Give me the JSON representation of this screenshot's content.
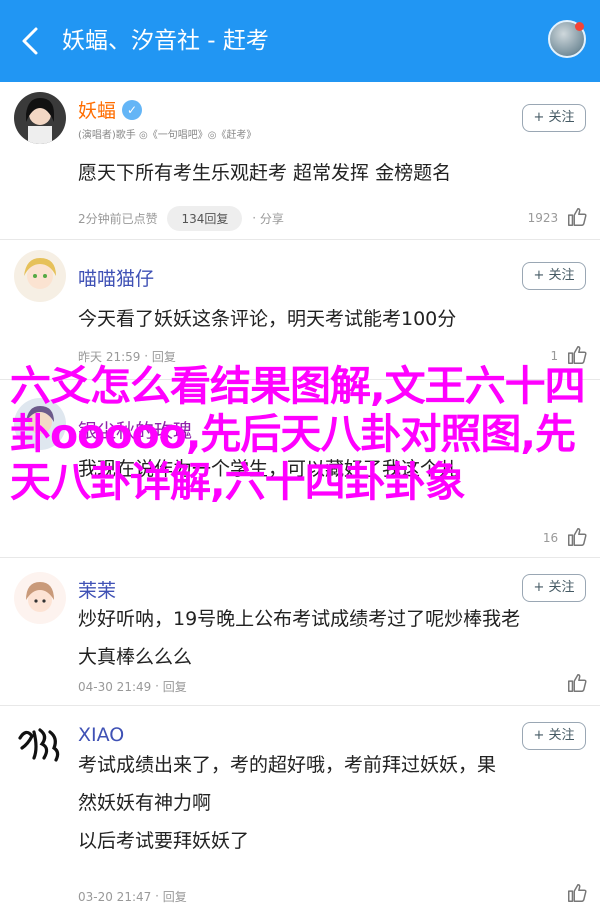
{
  "header": {
    "title": "妖蝠、汐音社 - 赶考"
  },
  "follow_label": "+ 关注",
  "comments": [
    {
      "name": "妖蝠",
      "verified": true,
      "meta": "(演唱者)歌手 ◎《一句唱吧》◎《赶考》",
      "lines": [
        "愿天下所有考生乐观赶考 超常发挥 金榜题名"
      ],
      "time": "2分钟前已点赞",
      "reply_count": "134回复",
      "share": "分享",
      "likes": "1923"
    },
    {
      "name": "喵喵猫仔",
      "lines": [
        "今天看了妖妖这条评论，明天考试能考100分"
      ],
      "time": "昨天 21:59",
      "reply": "回复",
      "likes": "1"
    },
    {
      "name": "银尘秋的玫瑰",
      "lines": [
        "我现在说作为一个学生，可以藏好了我这个儿"
      ],
      "time": "",
      "reply": "",
      "likes": "16"
    },
    {
      "name": "茉茉",
      "lines": [
        "炒好听呐，19号晚上公布考试成绩考过了呢炒棒我老",
        "大真棒么么么"
      ],
      "time": "04-30 21:49",
      "reply": "回复",
      "likes": ""
    },
    {
      "name": "XIAO",
      "lines": [
        "考试成绩出来了，考的超好哦，考前拜过妖妖，果",
        "然妖妖有神力啊",
        "以后考试要拜妖妖了"
      ],
      "time": "03-20 21:47",
      "reply": "回复",
      "likes": ""
    }
  ],
  "overlay": {
    "text": "六爻怎么看结果图解,文王六十四卦ooooo,先后天八卦对照图,先天八卦详解,六十四卦卦象"
  },
  "colors": {
    "header_bg": "#2196f3",
    "name_orange": "#ff6d00",
    "overlay": "#ff00ff"
  }
}
